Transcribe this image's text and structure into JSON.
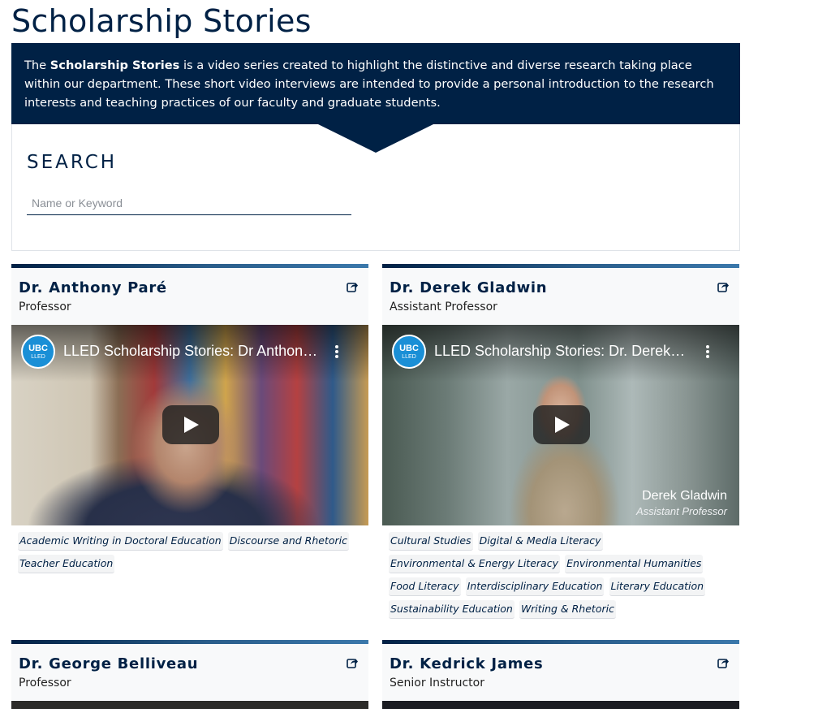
{
  "page": {
    "title": "Scholarship Stories",
    "intro": {
      "before": "The ",
      "bold": "Scholarship Stories",
      "after": " is a video series created to highlight the distinctive and diverse research taking place within our department. These short video interviews are intended to provide a personal introduction to the research interests and teaching practices of our faculty and graduate students."
    }
  },
  "search": {
    "heading": "SEARCH",
    "placeholder": "Name or Keyword",
    "value": ""
  },
  "cards": [
    {
      "name": "Dr. Anthony Paré",
      "role": "Professor",
      "video": {
        "logo_top": "UBC",
        "logo_bottom": "LLED",
        "title": "LLED Scholarship Stories: Dr Anthony Paré"
      },
      "tags": [
        "Academic Writing in Doctoral Education",
        "Discourse and Rhetoric",
        "Teacher Education"
      ]
    },
    {
      "name": "Dr. Derek Gladwin",
      "role": "Assistant Professor",
      "video": {
        "logo_top": "UBC",
        "logo_bottom": "LLED",
        "title": "LLED Scholarship Stories: Dr. Derek Gladwin",
        "caption_name": "Derek Gladwin",
        "caption_role": "Assistant Professor"
      },
      "tags": [
        "Cultural Studies",
        "Digital & Media Literacy",
        "Environmental & Energy Literacy",
        "Environmental Humanities",
        "Food Literacy",
        "Interdisciplinary Education",
        "Literary Education",
        "Sustainability Education",
        "Writing & Rhetoric"
      ]
    },
    {
      "name": "Dr. George Belliveau",
      "role": "Professor"
    },
    {
      "name": "Dr. Kedrick James",
      "role": "Senior Instructor"
    }
  ],
  "colors": {
    "brand_navy": "#002145",
    "logo_blue": "#1a8fd6",
    "card_header_bg": "#f8f9fa"
  },
  "icons": {
    "share": "share-icon",
    "play": "play-icon",
    "menu": "more-vertical-icon"
  }
}
